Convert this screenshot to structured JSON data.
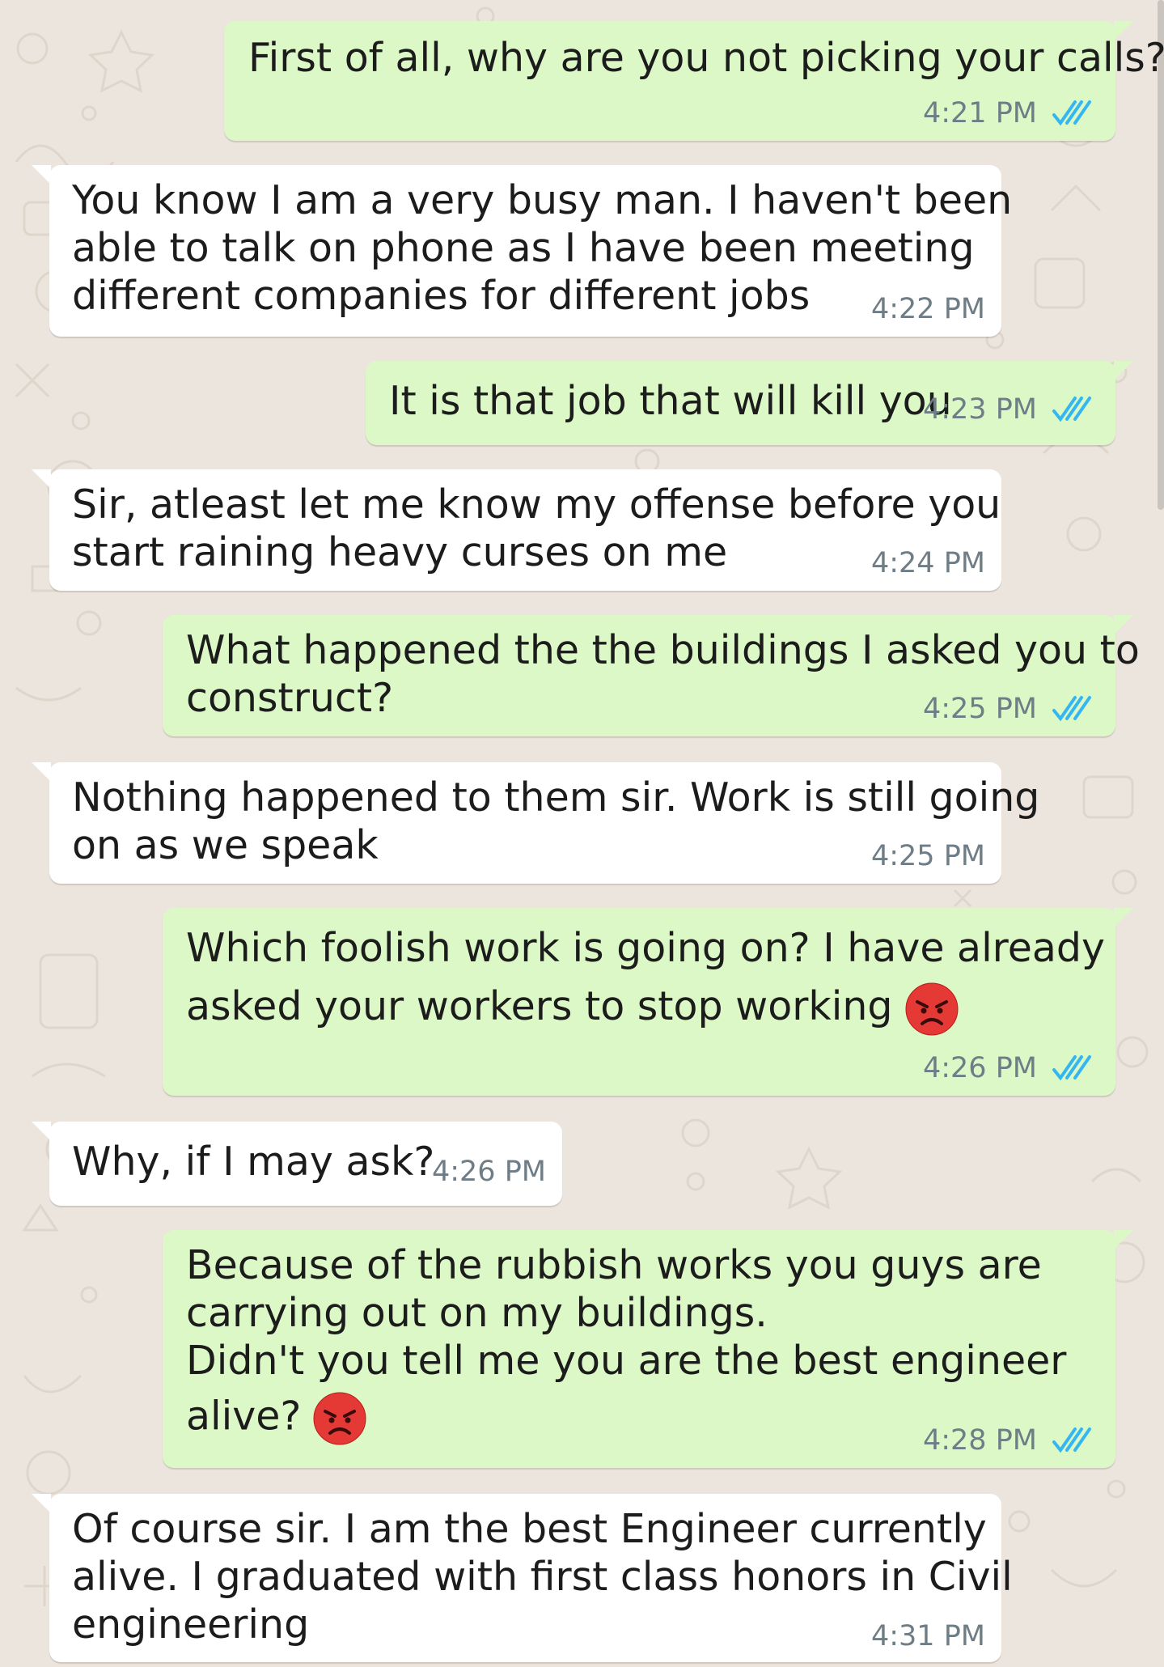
{
  "colors": {
    "background": "#ece5dd",
    "outgoing_bubble": "#dcf8c6",
    "incoming_bubble": "#ffffff",
    "read_ticks": "#34b7f1",
    "timestamp": "#6f7d86"
  },
  "messages": [
    {
      "direction": "outgoing",
      "lines": [
        "First of all, why are you not picking your calls?"
      ],
      "time": "4:21 PM",
      "status_icon": "double-check-read-icon"
    },
    {
      "direction": "incoming",
      "lines": [
        "You know I am a very busy man. I haven't been",
        "able to talk on phone as I have been meeting",
        "different companies for different jobs"
      ],
      "time": "4:22 PM"
    },
    {
      "direction": "outgoing",
      "lines": [
        "It is that job that will kill you"
      ],
      "time": "4:23 PM",
      "status_icon": "double-check-read-icon"
    },
    {
      "direction": "incoming",
      "lines": [
        "Sir, atleast let me know my offense before you",
        "start raining heavy curses on me"
      ],
      "time": "4:24 PM"
    },
    {
      "direction": "outgoing",
      "lines": [
        "What happened the the buildings I asked you to",
        "construct?"
      ],
      "time": "4:25 PM",
      "status_icon": "double-check-read-icon"
    },
    {
      "direction": "incoming",
      "lines": [
        "Nothing happened to them sir. Work is still going",
        "on as we speak"
      ],
      "time": "4:25 PM"
    },
    {
      "direction": "outgoing",
      "lines": [
        "Which foolish work is going on? I have already",
        "asked your workers to stop working"
      ],
      "time": "4:26 PM",
      "status_icon": "double-check-read-icon",
      "emoji": "angry-face-emoji"
    },
    {
      "direction": "incoming",
      "lines": [
        "Why, if I may ask?"
      ],
      "time": "4:26 PM"
    },
    {
      "direction": "outgoing",
      "lines": [
        "Because of the rubbish works you guys are",
        "carrying out on my buildings.",
        "Didn't you tell me you are the best engineer",
        "alive?"
      ],
      "time": "4:28 PM",
      "status_icon": "double-check-read-icon",
      "emoji": "angry-face-emoji"
    },
    {
      "direction": "incoming",
      "lines": [
        "Of course sir. I am the best Engineer currently",
        "alive. I graduated with first class honors in Civil",
        "engineering"
      ],
      "time": "4:31 PM"
    }
  ]
}
